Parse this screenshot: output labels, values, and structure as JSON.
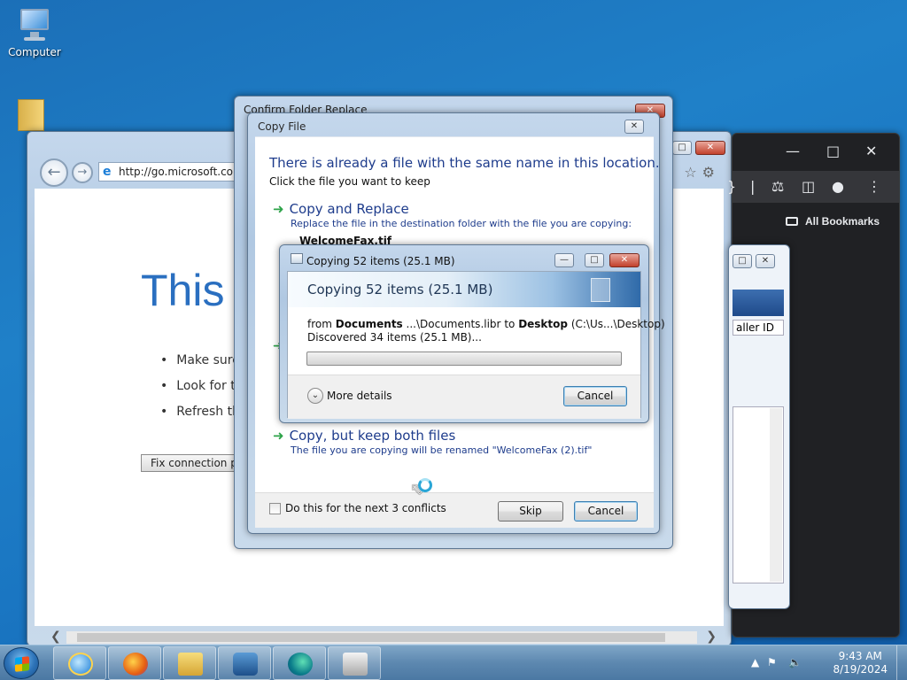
{
  "desktop": {
    "icons": [
      {
        "label": "Computer",
        "icon": "computer-icon"
      },
      {
        "label": "",
        "icon": "folder-icon"
      }
    ]
  },
  "ie_window": {
    "address": "http://go.microsoft.com",
    "heading": "This",
    "bullets": [
      "Make sure",
      "Look for t",
      "Refresh th"
    ],
    "fix_button": "Fix connection pro"
  },
  "chrome_window": {
    "bookmarks_label": "All Bookmarks"
  },
  "callerid_window": {
    "column_label": "aller ID"
  },
  "folder_replace_window": {
    "title": "Confirm Folder Replace"
  },
  "copy_file_dialog": {
    "title": "Copy File",
    "heading": "There is already a file with the same name in this location.",
    "subheading": "Click the file you want to keep",
    "option_replace": {
      "label": "Copy and Replace",
      "description": "Replace the file in the destination folder with the file you are copying:",
      "filename": "WelcomeFax.tif"
    },
    "option_keep_both": {
      "label": "Copy, but keep both files",
      "description": "The file you are copying will be renamed \"WelcomeFax (2).tif\""
    },
    "checkbox_label": "Do this for the next 3 conflicts",
    "checkbox_checked": false,
    "skip_button": "Skip",
    "cancel_button": "Cancel"
  },
  "progress_window": {
    "title": "Copying 52 items (25.1 MB)",
    "banner": "Copying 52 items (25.1 MB)",
    "from_prefix": "from",
    "from_source": "Documents",
    "from_source_path": "...\\Documents.libr",
    "to_prefix": "to",
    "to_dest": "Desktop",
    "to_dest_path": "(C:\\Us...\\Desktop)",
    "status": "Discovered 34 items (25.1 MB)...",
    "progress_fraction": 0.0,
    "more_details": "More details",
    "cancel_button": "Cancel"
  },
  "taskbar": {
    "apps": [
      "internet-explorer-icon",
      "firefox-icon",
      "file-explorer-icon",
      "media-player-icon",
      "edge-icon",
      "fax-scan-icon"
    ],
    "time": "9:43 AM",
    "date": "8/19/2024"
  },
  "colors": {
    "link_blue": "#1e3c8c",
    "green_arrow": "#2ea34a",
    "desktop_blue": "#1f80c8"
  }
}
